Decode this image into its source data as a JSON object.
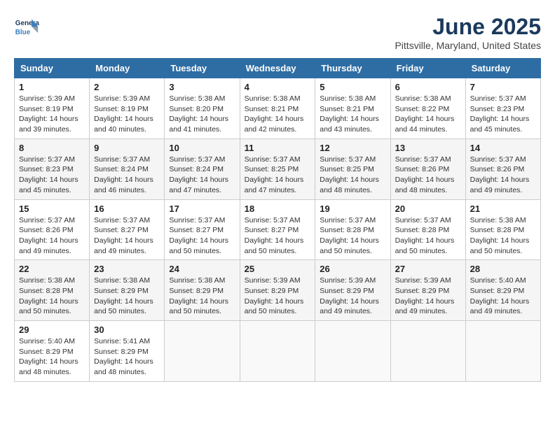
{
  "logo": {
    "line1": "General",
    "line2": "Blue"
  },
  "title": "June 2025",
  "subtitle": "Pittsville, Maryland, United States",
  "days_of_week": [
    "Sunday",
    "Monday",
    "Tuesday",
    "Wednesday",
    "Thursday",
    "Friday",
    "Saturday"
  ],
  "weeks": [
    [
      {
        "day": "1",
        "sunrise": "5:39 AM",
        "sunset": "8:19 PM",
        "daylight": "14 hours and 39 minutes."
      },
      {
        "day": "2",
        "sunrise": "5:39 AM",
        "sunset": "8:19 PM",
        "daylight": "14 hours and 40 minutes."
      },
      {
        "day": "3",
        "sunrise": "5:38 AM",
        "sunset": "8:20 PM",
        "daylight": "14 hours and 41 minutes."
      },
      {
        "day": "4",
        "sunrise": "5:38 AM",
        "sunset": "8:21 PM",
        "daylight": "14 hours and 42 minutes."
      },
      {
        "day": "5",
        "sunrise": "5:38 AM",
        "sunset": "8:21 PM",
        "daylight": "14 hours and 43 minutes."
      },
      {
        "day": "6",
        "sunrise": "5:38 AM",
        "sunset": "8:22 PM",
        "daylight": "14 hours and 44 minutes."
      },
      {
        "day": "7",
        "sunrise": "5:37 AM",
        "sunset": "8:23 PM",
        "daylight": "14 hours and 45 minutes."
      }
    ],
    [
      {
        "day": "8",
        "sunrise": "5:37 AM",
        "sunset": "8:23 PM",
        "daylight": "14 hours and 45 minutes."
      },
      {
        "day": "9",
        "sunrise": "5:37 AM",
        "sunset": "8:24 PM",
        "daylight": "14 hours and 46 minutes."
      },
      {
        "day": "10",
        "sunrise": "5:37 AM",
        "sunset": "8:24 PM",
        "daylight": "14 hours and 47 minutes."
      },
      {
        "day": "11",
        "sunrise": "5:37 AM",
        "sunset": "8:25 PM",
        "daylight": "14 hours and 47 minutes."
      },
      {
        "day": "12",
        "sunrise": "5:37 AM",
        "sunset": "8:25 PM",
        "daylight": "14 hours and 48 minutes."
      },
      {
        "day": "13",
        "sunrise": "5:37 AM",
        "sunset": "8:26 PM",
        "daylight": "14 hours and 48 minutes."
      },
      {
        "day": "14",
        "sunrise": "5:37 AM",
        "sunset": "8:26 PM",
        "daylight": "14 hours and 49 minutes."
      }
    ],
    [
      {
        "day": "15",
        "sunrise": "5:37 AM",
        "sunset": "8:26 PM",
        "daylight": "14 hours and 49 minutes."
      },
      {
        "day": "16",
        "sunrise": "5:37 AM",
        "sunset": "8:27 PM",
        "daylight": "14 hours and 49 minutes."
      },
      {
        "day": "17",
        "sunrise": "5:37 AM",
        "sunset": "8:27 PM",
        "daylight": "14 hours and 50 minutes."
      },
      {
        "day": "18",
        "sunrise": "5:37 AM",
        "sunset": "8:27 PM",
        "daylight": "14 hours and 50 minutes."
      },
      {
        "day": "19",
        "sunrise": "5:37 AM",
        "sunset": "8:28 PM",
        "daylight": "14 hours and 50 minutes."
      },
      {
        "day": "20",
        "sunrise": "5:37 AM",
        "sunset": "8:28 PM",
        "daylight": "14 hours and 50 minutes."
      },
      {
        "day": "21",
        "sunrise": "5:38 AM",
        "sunset": "8:28 PM",
        "daylight": "14 hours and 50 minutes."
      }
    ],
    [
      {
        "day": "22",
        "sunrise": "5:38 AM",
        "sunset": "8:28 PM",
        "daylight": "14 hours and 50 minutes."
      },
      {
        "day": "23",
        "sunrise": "5:38 AM",
        "sunset": "8:29 PM",
        "daylight": "14 hours and 50 minutes."
      },
      {
        "day": "24",
        "sunrise": "5:38 AM",
        "sunset": "8:29 PM",
        "daylight": "14 hours and 50 minutes."
      },
      {
        "day": "25",
        "sunrise": "5:39 AM",
        "sunset": "8:29 PM",
        "daylight": "14 hours and 50 minutes."
      },
      {
        "day": "26",
        "sunrise": "5:39 AM",
        "sunset": "8:29 PM",
        "daylight": "14 hours and 49 minutes."
      },
      {
        "day": "27",
        "sunrise": "5:39 AM",
        "sunset": "8:29 PM",
        "daylight": "14 hours and 49 minutes."
      },
      {
        "day": "28",
        "sunrise": "5:40 AM",
        "sunset": "8:29 PM",
        "daylight": "14 hours and 49 minutes."
      }
    ],
    [
      {
        "day": "29",
        "sunrise": "5:40 AM",
        "sunset": "8:29 PM",
        "daylight": "14 hours and 48 minutes."
      },
      {
        "day": "30",
        "sunrise": "5:41 AM",
        "sunset": "8:29 PM",
        "daylight": "14 hours and 48 minutes."
      },
      null,
      null,
      null,
      null,
      null
    ]
  ],
  "labels": {
    "sunrise": "Sunrise:",
    "sunset": "Sunset:",
    "daylight": "Daylight:"
  }
}
